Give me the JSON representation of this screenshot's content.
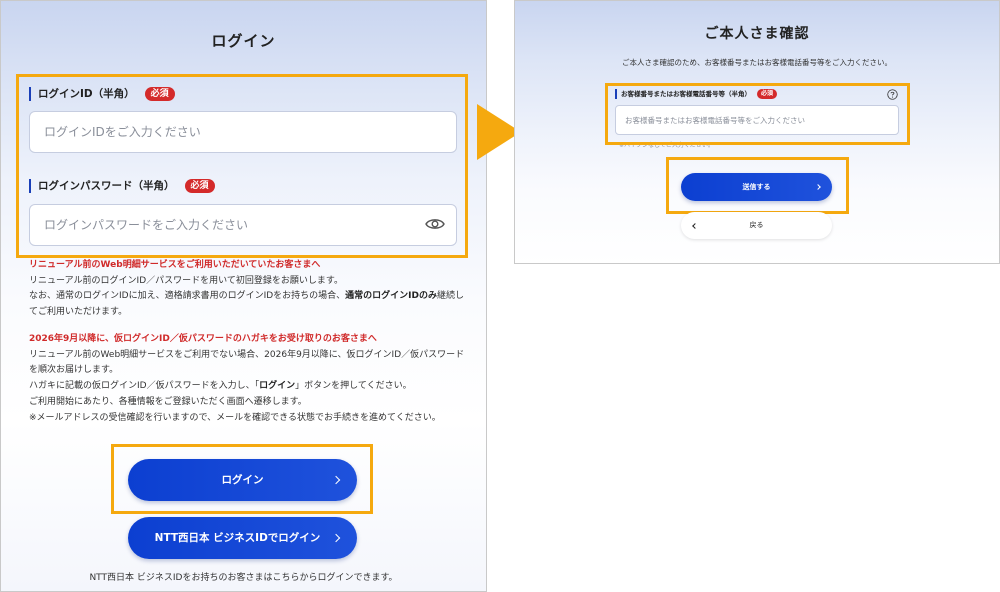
{
  "login": {
    "title": "ログイン",
    "id_label": "ログインID（半角）",
    "required": "必須",
    "id_placeholder": "ログインIDをご入力ください",
    "password_label": "ログインパスワード（半角）",
    "password_placeholder": "ログインパスワードをご入力ください",
    "notice1": {
      "heading": "リニューアル前のWeb明細サービスをご利用いただいていたお客さまへ",
      "line1": "リニューアル前のログインID／パスワードを用いて初回登録をお願いします。",
      "line2_before": "なお、通常のログインIDに加え、適格請求書用のログインIDをお持ちの場合、",
      "line2_bold": "通常のログインIDのみ",
      "line2_after": "継続してご利用いただけます。"
    },
    "notice2": {
      "heading": "2026年9月以降に、仮ログインID／仮パスワードのハガキをお受け取りのお客さまへ",
      "line1": "リニューアル前のWeb明細サービスをご利用でない場合、2026年9月以降に、仮ログインID／仮パスワードを順次お届けします。",
      "line2_before": "ハガキに記載の仮ログインID／仮パスワードを入力し、「",
      "line2_bold": "ログイン",
      "line2_after": "」ボタンを押してください。",
      "line3": "ご利用開始にあたり、各種情報をご登録いただく画面へ遷移します。",
      "line4": "※メールアドレスの受信確認を行いますので、メールを確認できる状態でお手続きを進めてください。"
    },
    "login_button": "ログイン",
    "business_button": "NTT西日本 ビジネスIDでログイン",
    "footnote": "NTT西日本 ビジネスIDをお持ちのお客さまはこちらからログインできます。"
  },
  "verify": {
    "title": "ご本人さま確認",
    "description": "ご本人さま確認のため、お客様番号またはお客様電話番号等をご入力ください。",
    "field_label": "お客様番号またはお客様電話番号等（半角）",
    "required": "必須",
    "placeholder": "お客様番号またはお客様電話番号等をご入力ください",
    "hint": "※ハイフンなしでご入力ください。",
    "submit_button": "送信する",
    "back_button": "戻る"
  },
  "colors": {
    "accent": "#0c3fd1",
    "required_badge": "#d42a2a",
    "highlight": "#f5a90f",
    "notice_heading": "#d02a2a"
  },
  "icons": {
    "password_toggle": "eye-icon",
    "help": "question-circle-icon",
    "next": "chevron-right-icon",
    "back": "chevron-left-icon",
    "flow": "triangle-arrow-right-icon"
  }
}
